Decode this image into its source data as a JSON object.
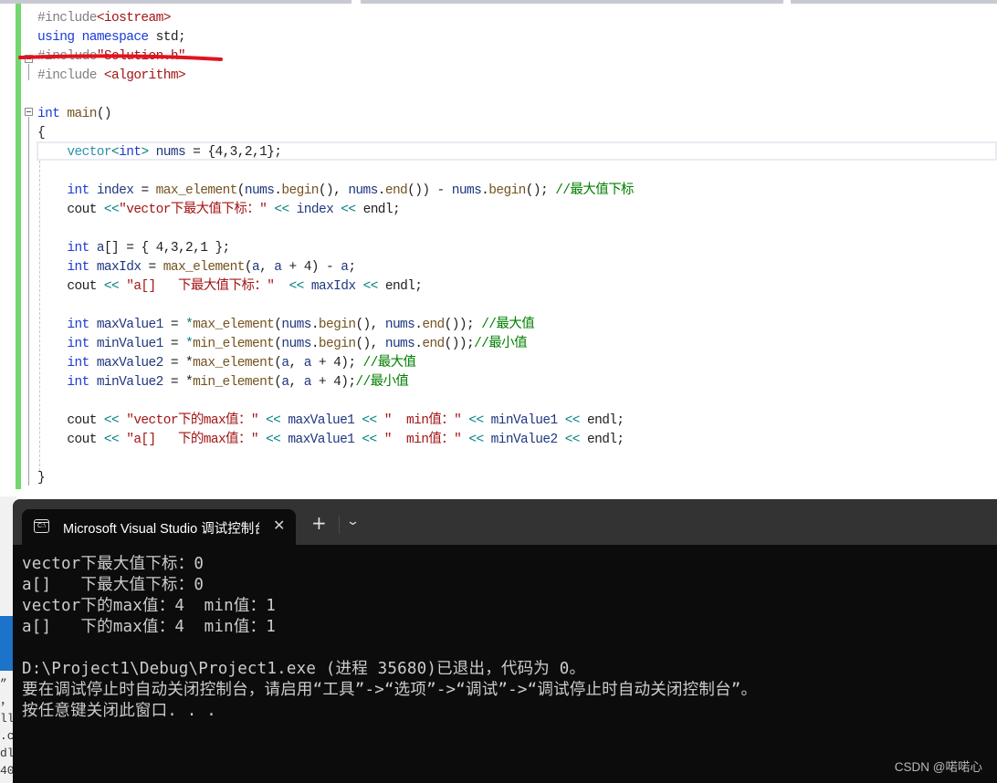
{
  "editor": {
    "lines": [
      {
        "tokens": [
          [
            "pp",
            "#include"
          ],
          [
            "inc",
            "<iostream>"
          ]
        ]
      },
      {
        "tokens": [
          [
            "kw",
            "using"
          ],
          [
            "plain",
            " "
          ],
          [
            "kw",
            "namespace"
          ],
          [
            "plain",
            " std;"
          ]
        ]
      },
      {
        "tokens": [
          [
            "pp",
            "#include"
          ],
          [
            "inc",
            "\"Solution.h\""
          ]
        ],
        "struck": true
      },
      {
        "tokens": [
          [
            "pp",
            "#include "
          ],
          [
            "inc",
            "<algorithm>"
          ]
        ]
      },
      {
        "tokens": []
      },
      {
        "tokens": [
          [
            "kw",
            "int"
          ],
          [
            "plain",
            " "
          ],
          [
            "fn",
            "main"
          ],
          [
            "plain",
            "()"
          ]
        ]
      },
      {
        "tokens": [
          [
            "plain",
            "{"
          ]
        ]
      },
      {
        "tokens": [
          [
            "plain",
            "    "
          ],
          [
            "typ",
            "vector"
          ],
          [
            "op",
            "<"
          ],
          [
            "kw",
            "int"
          ],
          [
            "op",
            ">"
          ],
          [
            "plain",
            " "
          ],
          [
            "var",
            "nums"
          ],
          [
            "plain",
            " = {4,3,2,1};"
          ]
        ]
      },
      {
        "tokens": []
      },
      {
        "tokens": [
          [
            "plain",
            "    "
          ],
          [
            "kw",
            "int"
          ],
          [
            "plain",
            " "
          ],
          [
            "var",
            "index"
          ],
          [
            "plain",
            " = "
          ],
          [
            "fn",
            "max_element"
          ],
          [
            "plain",
            "("
          ],
          [
            "var",
            "nums"
          ],
          [
            "plain",
            "."
          ],
          [
            "fn",
            "begin"
          ],
          [
            "plain",
            "(), "
          ],
          [
            "var",
            "nums"
          ],
          [
            "plain",
            "."
          ],
          [
            "fn",
            "end"
          ],
          [
            "plain",
            "()) - "
          ],
          [
            "var",
            "nums"
          ],
          [
            "plain",
            "."
          ],
          [
            "fn",
            "begin"
          ],
          [
            "plain",
            "(); "
          ],
          [
            "cm",
            "//最大值下标"
          ]
        ]
      },
      {
        "tokens": [
          [
            "plain",
            "    cout "
          ],
          [
            "op",
            "<<"
          ],
          [
            "str",
            "\"vector下最大值下标：\""
          ],
          [
            "plain",
            " "
          ],
          [
            "op",
            "<<"
          ],
          [
            "plain",
            " "
          ],
          [
            "var",
            "index"
          ],
          [
            "plain",
            " "
          ],
          [
            "op",
            "<<"
          ],
          [
            "plain",
            " endl;"
          ]
        ]
      },
      {
        "tokens": []
      },
      {
        "tokens": [
          [
            "plain",
            "    "
          ],
          [
            "kw",
            "int"
          ],
          [
            "plain",
            " "
          ],
          [
            "var",
            "a"
          ],
          [
            "plain",
            "[] = { 4,3,2,1 };"
          ]
        ]
      },
      {
        "tokens": [
          [
            "plain",
            "    "
          ],
          [
            "kw",
            "int"
          ],
          [
            "plain",
            " "
          ],
          [
            "var",
            "maxIdx"
          ],
          [
            "plain",
            " = "
          ],
          [
            "fn",
            "max_element"
          ],
          [
            "plain",
            "("
          ],
          [
            "var",
            "a"
          ],
          [
            "plain",
            ", "
          ],
          [
            "var",
            "a"
          ],
          [
            "plain",
            " + 4) - "
          ],
          [
            "var",
            "a"
          ],
          [
            "plain",
            ";"
          ]
        ]
      },
      {
        "tokens": [
          [
            "plain",
            "    cout "
          ],
          [
            "op",
            "<<"
          ],
          [
            "plain",
            " "
          ],
          [
            "str",
            "\"a[]   下最大值下标：\""
          ],
          [
            "plain",
            "  "
          ],
          [
            "op",
            "<<"
          ],
          [
            "plain",
            " "
          ],
          [
            "var",
            "maxIdx"
          ],
          [
            "plain",
            " "
          ],
          [
            "op",
            "<<"
          ],
          [
            "plain",
            " endl;"
          ]
        ]
      },
      {
        "tokens": []
      },
      {
        "tokens": [
          [
            "plain",
            "    "
          ],
          [
            "kw",
            "int"
          ],
          [
            "plain",
            " "
          ],
          [
            "var",
            "maxValue1"
          ],
          [
            "plain",
            " = "
          ],
          [
            "op",
            "*"
          ],
          [
            "fn",
            "max_element"
          ],
          [
            "plain",
            "("
          ],
          [
            "var",
            "nums"
          ],
          [
            "plain",
            "."
          ],
          [
            "fn",
            "begin"
          ],
          [
            "plain",
            "(), "
          ],
          [
            "var",
            "nums"
          ],
          [
            "plain",
            "."
          ],
          [
            "fn",
            "end"
          ],
          [
            "plain",
            "()); "
          ],
          [
            "cm",
            "//最大值"
          ]
        ]
      },
      {
        "tokens": [
          [
            "plain",
            "    "
          ],
          [
            "kw",
            "int"
          ],
          [
            "plain",
            " "
          ],
          [
            "var",
            "minValue1"
          ],
          [
            "plain",
            " = "
          ],
          [
            "op",
            "*"
          ],
          [
            "fn",
            "min_element"
          ],
          [
            "plain",
            "("
          ],
          [
            "var",
            "nums"
          ],
          [
            "plain",
            "."
          ],
          [
            "fn",
            "begin"
          ],
          [
            "plain",
            "(), "
          ],
          [
            "var",
            "nums"
          ],
          [
            "plain",
            "."
          ],
          [
            "fn",
            "end"
          ],
          [
            "plain",
            "());"
          ],
          [
            "cm",
            "//最小值"
          ]
        ]
      },
      {
        "tokens": [
          [
            "plain",
            "    "
          ],
          [
            "kw",
            "int"
          ],
          [
            "plain",
            " "
          ],
          [
            "var",
            "maxValue2"
          ],
          [
            "plain",
            " = *"
          ],
          [
            "fn",
            "max_element"
          ],
          [
            "plain",
            "("
          ],
          [
            "var",
            "a"
          ],
          [
            "plain",
            ", "
          ],
          [
            "var",
            "a"
          ],
          [
            "plain",
            " + 4); "
          ],
          [
            "cm",
            "//最大值"
          ]
        ]
      },
      {
        "tokens": [
          [
            "plain",
            "    "
          ],
          [
            "kw",
            "int"
          ],
          [
            "plain",
            " "
          ],
          [
            "var",
            "minValue2"
          ],
          [
            "plain",
            " = *"
          ],
          [
            "fn",
            "min_element"
          ],
          [
            "plain",
            "("
          ],
          [
            "var",
            "a"
          ],
          [
            "plain",
            ", "
          ],
          [
            "var",
            "a"
          ],
          [
            "plain",
            " + 4);"
          ],
          [
            "cm",
            "//最小值"
          ]
        ]
      },
      {
        "tokens": []
      },
      {
        "tokens": [
          [
            "plain",
            "    cout "
          ],
          [
            "op",
            "<<"
          ],
          [
            "plain",
            " "
          ],
          [
            "str",
            "\"vector下的max值：\""
          ],
          [
            "plain",
            " "
          ],
          [
            "op",
            "<<"
          ],
          [
            "plain",
            " "
          ],
          [
            "var",
            "maxValue1"
          ],
          [
            "plain",
            " "
          ],
          [
            "op",
            "<<"
          ],
          [
            "plain",
            " "
          ],
          [
            "str",
            "\"  min值：\""
          ],
          [
            "plain",
            " "
          ],
          [
            "op",
            "<<"
          ],
          [
            "plain",
            " "
          ],
          [
            "var",
            "minValue1"
          ],
          [
            "plain",
            " "
          ],
          [
            "op",
            "<<"
          ],
          [
            "plain",
            " endl;"
          ]
        ]
      },
      {
        "tokens": [
          [
            "plain",
            "    cout "
          ],
          [
            "op",
            "<<"
          ],
          [
            "plain",
            " "
          ],
          [
            "str",
            "\"a[]   下的max值：\""
          ],
          [
            "plain",
            " "
          ],
          [
            "op",
            "<<"
          ],
          [
            "plain",
            " "
          ],
          [
            "var",
            "maxValue1"
          ],
          [
            "plain",
            " "
          ],
          [
            "op",
            "<<"
          ],
          [
            "plain",
            " "
          ],
          [
            "str",
            "\"  min值：\""
          ],
          [
            "plain",
            " "
          ],
          [
            "op",
            "<<"
          ],
          [
            "plain",
            " "
          ],
          [
            "var",
            "minValue2"
          ],
          [
            "plain",
            " "
          ],
          [
            "op",
            "<<"
          ],
          [
            "plain",
            " endl;"
          ]
        ]
      },
      {
        "tokens": []
      },
      {
        "tokens": [
          [
            "plain",
            "}"
          ]
        ]
      }
    ]
  },
  "left_peek": {
    "fragments": [
      "”",
      "，",
      "ll",
      ".c",
      "dl",
      "40"
    ]
  },
  "terminal": {
    "tab_title": "Microsoft Visual Studio 调试控制台",
    "tab_icon": "C:\\",
    "close_glyph": "✕",
    "new_tab_glyph": "+",
    "dropdown_glyph": "⌄",
    "output": [
      "vector下最大值下标：0",
      "a[]   下最大值下标：0",
      "vector下的max值：4  min值：1",
      "a[]   下的max值：4  min值：1",
      "",
      "D:\\Project1\\Debug\\Project1.exe (进程 35680)已退出，代码为 0。",
      "要在调试停止时自动关闭控制台，请启用“工具”->“选项”->“调试”->“调试停止时自动关闭控制台”。",
      "按任意键关闭此窗口. . ."
    ],
    "watermark": "CSDN @喏喏心"
  },
  "colors": {
    "keyword": "#1a3bd6",
    "string": "#a31515",
    "comment": "#008000",
    "type": "#2b91af",
    "function": "#74531f",
    "variable": "#1f377f",
    "change_bar": "#73d66e",
    "terminal_bg": "#0c0c0c",
    "terminal_text": "#cccccc",
    "annotation_red": "#e0141e"
  }
}
